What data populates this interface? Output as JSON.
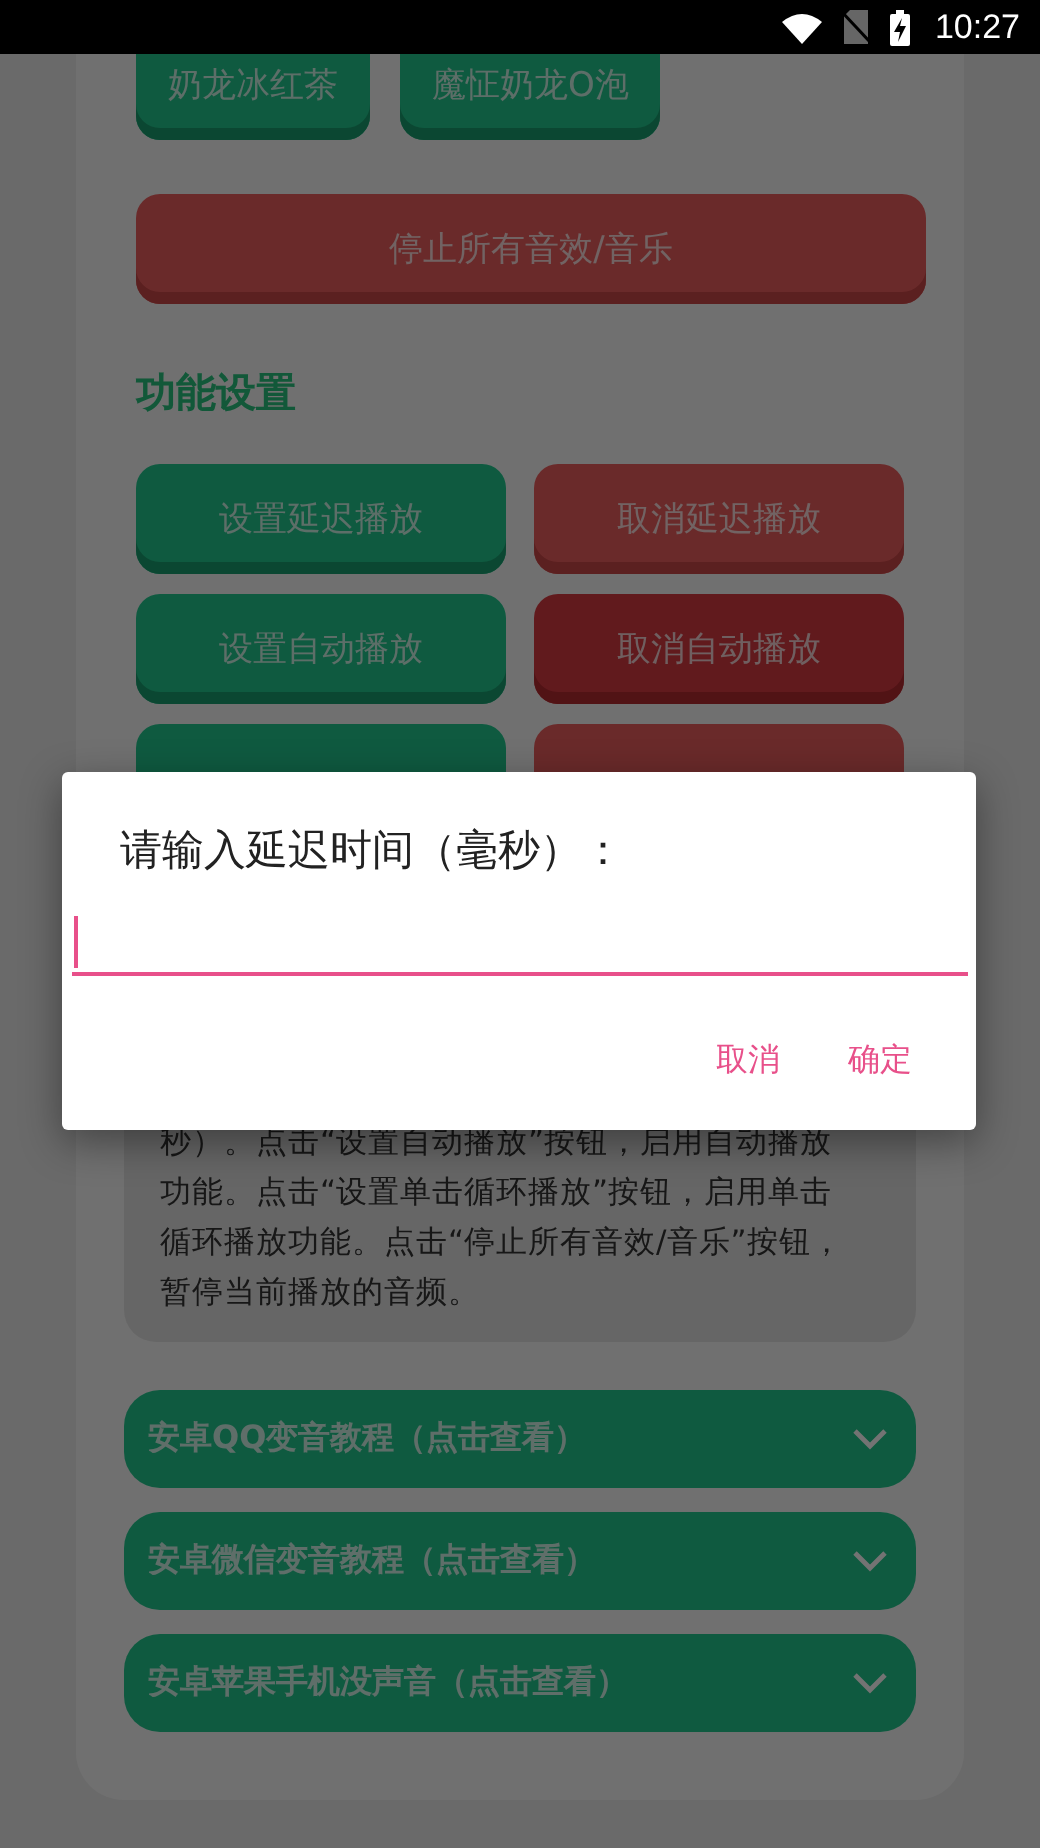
{
  "status_bar": {
    "time": "10:27"
  },
  "top_buttons": [
    {
      "label": "奶龙冰红茶"
    },
    {
      "label": "魔怔奶龙O泡"
    }
  ],
  "stop_button": {
    "label": "停止所有音效/音乐"
  },
  "settings": {
    "heading": "功能设置",
    "buttons": [
      {
        "label": "设置延迟播放",
        "kind": "set",
        "pressed": false
      },
      {
        "label": "取消延迟播放",
        "kind": "cancel",
        "pressed": false
      },
      {
        "label": "设置自动播放",
        "kind": "set",
        "pressed": false
      },
      {
        "label": "取消自动播放",
        "kind": "cancel",
        "pressed": true
      },
      {
        "kind": "set",
        "pressed": false
      },
      {
        "kind": "cancel",
        "pressed": false
      }
    ]
  },
  "description": "秒）。点击“设置自动播放”按钮，启用自动播放功能。点击“设置单击循环播放”按钮，启用单击循环播放功能。点击“停止所有音效/音乐”按钮，暂停当前播放的音频。",
  "tutorials": [
    {
      "title": "安卓QQ变音教程（点击查看）",
      "expanded": false
    },
    {
      "title": "安卓微信变音教程（点击查看）",
      "expanded": false
    },
    {
      "title": "安卓苹果手机没声音（点击查看）",
      "expanded": false
    }
  ],
  "dialog": {
    "title": "请输入延迟时间（毫秒）：",
    "buttons": [
      "取消",
      "确定"
    ]
  }
}
